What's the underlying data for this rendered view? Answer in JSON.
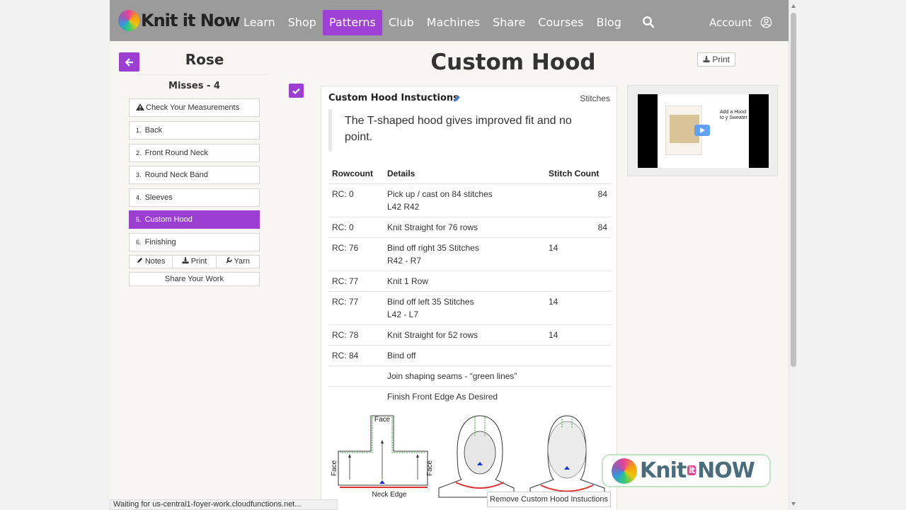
{
  "nav": {
    "brand": "Knit it Now",
    "links": [
      "Learn",
      "Shop",
      "Patterns",
      "Club",
      "Machines",
      "Share",
      "Courses",
      "Blog"
    ],
    "account": "Account"
  },
  "sidebar": {
    "title": "Rose",
    "size": "Misses - 4",
    "measurements": "Check Your Measurements",
    "items": [
      {
        "num": "1.",
        "label": "Back"
      },
      {
        "num": "2.",
        "label": "Front Round Neck"
      },
      {
        "num": "3.",
        "label": "Round Neck Band"
      },
      {
        "num": "4.",
        "label": "Sleeves"
      },
      {
        "num": "5.",
        "label": "Custom Hood"
      },
      {
        "num": "6.",
        "label": "Finishing"
      }
    ],
    "tools": {
      "notes": "Notes",
      "print": "Print",
      "yarn": "Yarn"
    },
    "share": "Share Your Work"
  },
  "main": {
    "title": "Custom Hood",
    "print": "Print",
    "card_title": "Custom Hood Instuctions",
    "stitches": "Stitches",
    "intro": "The T-shaped hood gives improved fit and no point.",
    "table": {
      "headers": [
        "Rowcount",
        "Details",
        "Stitch Count"
      ],
      "rows": [
        {
          "rc": "RC: 0",
          "details": "Pick up / cast on 84 stitches",
          "details2": "L42 R42",
          "mid": "",
          "count": "84"
        },
        {
          "rc": "RC: 0",
          "details": "Knit Straight for 76 rows",
          "details2": "",
          "mid": "",
          "count": "84"
        },
        {
          "rc": "RC: 76",
          "details": "Bind off right 35 Stitches",
          "details2": "R42 - R7",
          "mid": "14",
          "count": ""
        },
        {
          "rc": "RC: 77",
          "details": "Knit 1 Row",
          "details2": "",
          "mid": "",
          "count": ""
        },
        {
          "rc": "RC: 77",
          "details": "Bind off left 35 Stitches",
          "details2": "L42 - L7",
          "mid": "14",
          "count": ""
        },
        {
          "rc": "RC: 78",
          "details": "Knit Straight for 52 rows",
          "details2": "",
          "mid": "14",
          "count": ""
        },
        {
          "rc": "RC: 84",
          "details": "Bind off",
          "details2": "",
          "mid": "",
          "count": ""
        },
        {
          "rc": "",
          "details": "Join shaping seams - “green lines”",
          "details2": "",
          "mid": "",
          "count": ""
        },
        {
          "rc": "",
          "details": "Finish Front Edge As Desired",
          "details2": "",
          "mid": "",
          "count": ""
        }
      ]
    },
    "diagram": {
      "face_top": "Face",
      "face_left": "Face",
      "face_right": "Face",
      "neck_edge": "Neck Edge"
    },
    "remove": "Remove Custom Hood Instuctions"
  },
  "video": {
    "caption": "Add a Hood to y Sweater"
  },
  "watermark": {
    "a": "Knit",
    "b": "it",
    "c": "NOW"
  },
  "status": "Waiting for us-central1-foyer-work.cloudfunctions.net..."
}
